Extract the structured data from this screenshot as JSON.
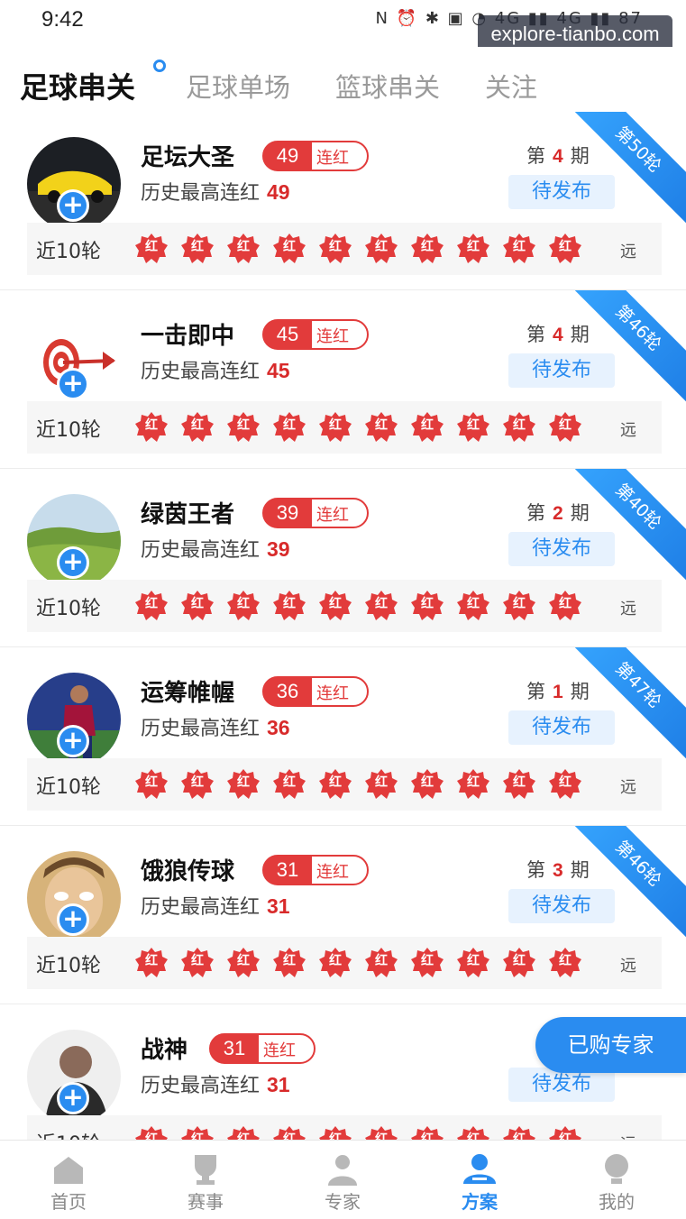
{
  "status_bar": {
    "time": "9:42",
    "icons_text": "N ⏰ ✱ ▣ ◔ 4G ▮▮ 4G ▮▮ 87"
  },
  "watermark": "explore-tianbo.com",
  "tabs": [
    {
      "label": "足球串关",
      "active": true
    },
    {
      "label": "足球单场",
      "active": false
    },
    {
      "label": "篮球串关",
      "active": false
    },
    {
      "label": "关注",
      "active": false
    }
  ],
  "common": {
    "streak_label": "连红",
    "history_prefix": "历史最高连红",
    "period_prefix": "第",
    "period_suffix": "期",
    "pending_label": "待发布",
    "recent_label": "近10轮",
    "red_badge": "红",
    "far_label": "远"
  },
  "experts": [
    {
      "name": "足坛大圣",
      "streak": "49",
      "history": "49",
      "period": "4",
      "ribbon": "第50轮"
    },
    {
      "name": "一击即中",
      "streak": "45",
      "history": "45",
      "period": "4",
      "ribbon": "第46轮"
    },
    {
      "name": "绿茵王者",
      "streak": "39",
      "history": "39",
      "period": "2",
      "ribbon": "第40轮"
    },
    {
      "name": "运筹帷幄",
      "streak": "36",
      "history": "36",
      "period": "1",
      "ribbon": "第47轮"
    },
    {
      "name": "饿狼传球",
      "streak": "31",
      "history": "31",
      "period": "3",
      "ribbon": "第46轮"
    },
    {
      "name": "战神",
      "streak": "31",
      "history": "31",
      "period": "",
      "ribbon": ""
    }
  ],
  "floating_button": "已购专家",
  "bottom_nav": [
    {
      "label": "首页",
      "icon": "home-icon",
      "active": false
    },
    {
      "label": "赛事",
      "icon": "trophy-icon",
      "active": false
    },
    {
      "label": "专家",
      "icon": "expert-icon",
      "active": false
    },
    {
      "label": "方案",
      "icon": "plan-icon",
      "active": true
    },
    {
      "label": "我的",
      "icon": "profile-icon",
      "active": false
    }
  ],
  "colors": {
    "accent": "#2a8cf0",
    "red": "#e23b3b",
    "background": "#f6f6f6"
  }
}
